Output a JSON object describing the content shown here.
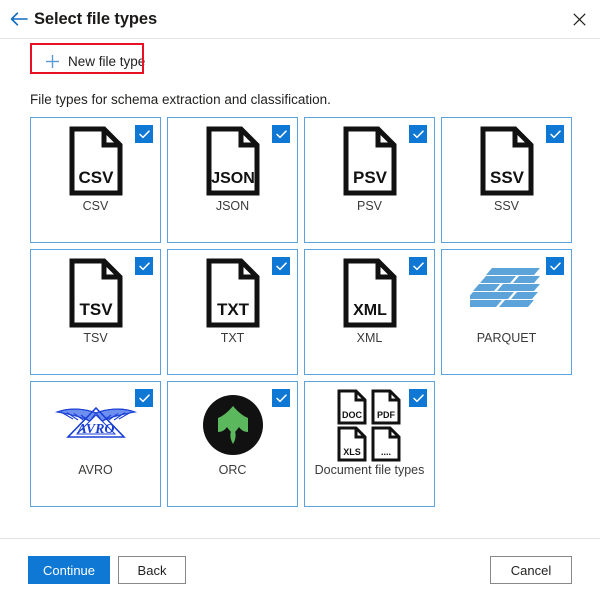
{
  "header": {
    "back_icon": "back-arrow-icon",
    "title": "Select file types",
    "close_icon": "close-icon"
  },
  "command_bar": {
    "new_file_type_label": "New file type",
    "plus_icon": "plus-icon",
    "annotation_color": "#e81123"
  },
  "description": "File types for schema extraction and classification.",
  "colors": {
    "accent": "#0f78d4",
    "card_border": "#5ba3e0",
    "parquet_blue": "#5ba3d8",
    "orc_green": "#5cb85c",
    "avro_blue": "#1a3fd4",
    "highlight_red": "#e81123"
  },
  "grid": {
    "cards": [
      {
        "id": "csv",
        "label": "CSV",
        "icon": "file-document-icon",
        "icon_text": "CSV",
        "checked": true
      },
      {
        "id": "json",
        "label": "JSON",
        "icon": "file-document-icon",
        "icon_text": "JSON",
        "checked": true
      },
      {
        "id": "psv",
        "label": "PSV",
        "icon": "file-document-icon",
        "icon_text": "PSV",
        "checked": true
      },
      {
        "id": "ssv",
        "label": "SSV",
        "icon": "file-document-icon",
        "icon_text": "SSV",
        "checked": true
      },
      {
        "id": "tsv",
        "label": "TSV",
        "icon": "file-document-icon",
        "icon_text": "TSV",
        "checked": true
      },
      {
        "id": "txt",
        "label": "TXT",
        "icon": "file-document-icon",
        "icon_text": "TXT",
        "checked": true
      },
      {
        "id": "xml",
        "label": "XML",
        "icon": "file-document-icon",
        "icon_text": "XML",
        "checked": true
      },
      {
        "id": "parquet",
        "label": "PARQUET",
        "icon": "parquet-logo-icon",
        "icon_text": "",
        "checked": true
      },
      {
        "id": "avro",
        "label": "AVRO",
        "icon": "avro-logo-icon",
        "icon_text": "AVRO",
        "checked": true
      },
      {
        "id": "orc",
        "label": "ORC",
        "icon": "orc-logo-icon",
        "icon_text": "",
        "checked": true
      },
      {
        "id": "document",
        "label": "Document file types",
        "icon": "multi-document-icon",
        "icon_text": "DOC,PDF,XLS,....",
        "checked": true
      }
    ],
    "document_icon_labels": [
      "DOC",
      "PDF",
      "XLS",
      "...."
    ]
  },
  "footer": {
    "continue_label": "Continue",
    "back_label": "Back",
    "cancel_label": "Cancel"
  }
}
